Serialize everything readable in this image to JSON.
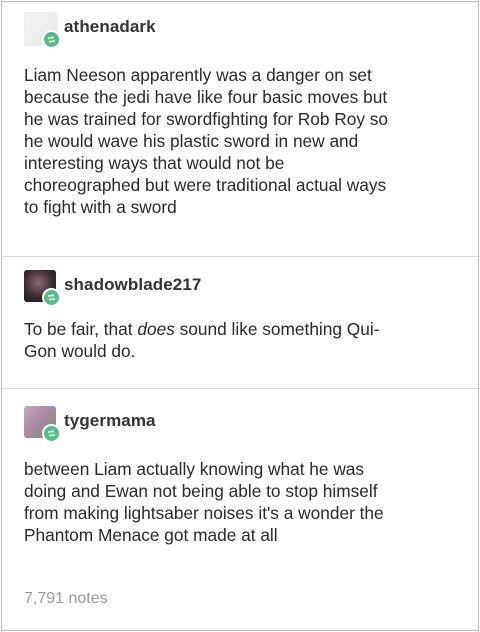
{
  "posts": [
    {
      "username": "athenadark",
      "avatar_icon": "blank-avatar",
      "badge_icon": "reblog-icon",
      "lines": [
        "Liam Neeson apparently was a danger on set",
        "because the jedi have like four basic moves but",
        "he was trained for swordfighting for Rob Roy so",
        "he would wave his plastic sword in new and",
        "interesting ways that would not be",
        "choreographed but were traditional actual ways",
        "to fight with a sword"
      ]
    },
    {
      "username": "shadowblade217",
      "avatar_icon": "dark-avatar",
      "badge_icon": "reblog-icon",
      "line1_pre": "To be fair, that ",
      "line1_em": "does",
      "line1_post": " sound like something Qui-",
      "line2": "Gon would do."
    },
    {
      "username": "tygermama",
      "avatar_icon": "pink-avatar",
      "badge_icon": "reblog-icon",
      "lines": [
        "between Liam actually knowing what he was",
        "doing and Ewan not being able to stop himself",
        "from making lightsaber noises it's a wonder the",
        "Phantom Menace got made at all"
      ]
    }
  ],
  "footer": {
    "notes": "7,791 notes"
  },
  "colors": {
    "badge": "#56bc8a",
    "text": "#2a2a2a",
    "notes": "#9a9a9a"
  }
}
